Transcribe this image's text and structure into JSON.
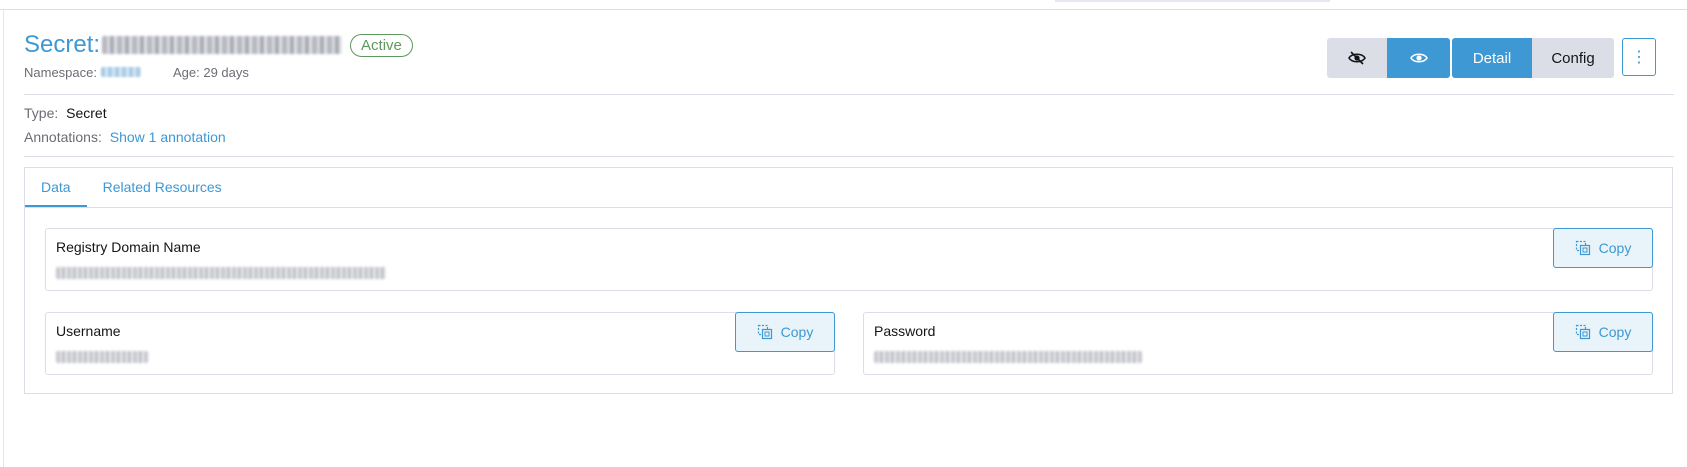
{
  "header": {
    "title_prefix": "Secret:",
    "status": "Active",
    "namespace_label": "Namespace:",
    "age_label": "Age: 29 days"
  },
  "toolbar": {
    "hide_icon": "eye-off-icon",
    "show_icon": "eye-icon",
    "detail_label": "Detail",
    "config_label": "Config",
    "more_label": "⋮"
  },
  "info": {
    "type_label": "Type:",
    "type_value": "Secret",
    "annotations_label": "Annotations:",
    "annotations_link": "Show 1 annotation"
  },
  "tabs": [
    {
      "label": "Data",
      "active": true
    },
    {
      "label": "Related Resources",
      "active": false
    }
  ],
  "fields": {
    "registry": {
      "label": "Registry Domain Name",
      "copy_label": "Copy"
    },
    "username": {
      "label": "Username",
      "copy_label": "Copy"
    },
    "password": {
      "label": "Password",
      "copy_label": "Copy"
    }
  },
  "colors": {
    "accent": "#3d98d3",
    "success": "#5d995d",
    "border": "#dcdee7"
  }
}
